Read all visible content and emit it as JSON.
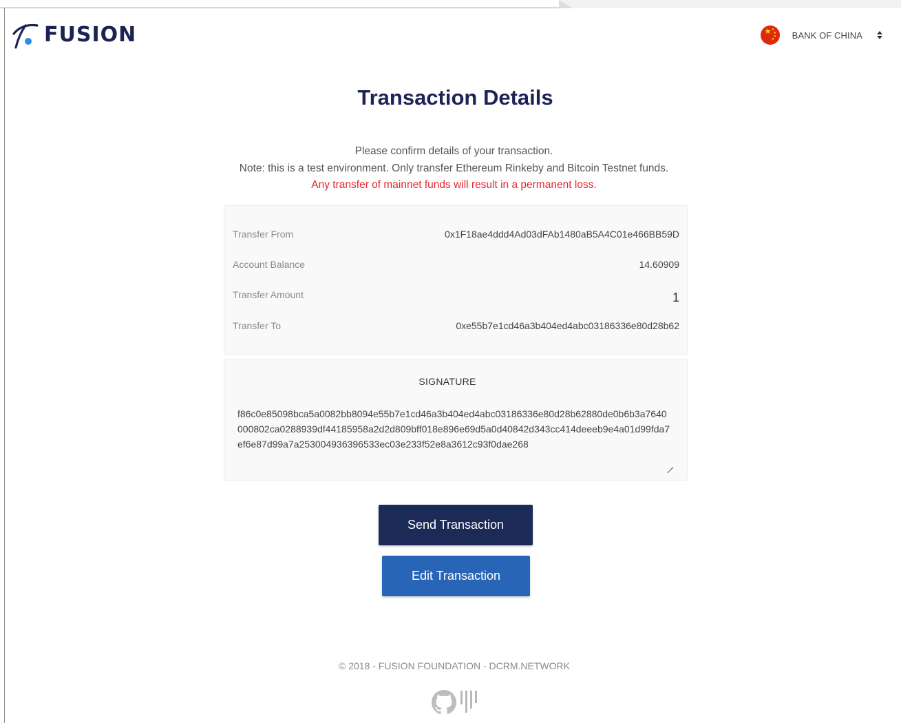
{
  "header": {
    "brand": "FUSION",
    "bank_selector": {
      "selected": "BANK OF CHINA",
      "flag_icon": "china-flag-icon"
    }
  },
  "page": {
    "title": "Transaction Details",
    "notes": {
      "line1": "Please confirm details of your transaction.",
      "line2": "Note: this is a test environment. Only transfer Ethereum Rinkeby and Bitcoin Testnet funds.",
      "warning": "Any transfer of mainnet funds will result in a permanent loss."
    }
  },
  "details": {
    "rows": [
      {
        "label": "Transfer From",
        "value": "0x1F18ae4ddd4Ad03dFAb1480aB5A4C01e466BB59D"
      },
      {
        "label": "Account Balance",
        "value": "14.60909"
      },
      {
        "label": "Transfer Amount",
        "value": "1"
      },
      {
        "label": "Transfer To",
        "value": "0xe55b7e1cd46a3b404ed4abc03186336e80d28b62"
      }
    ]
  },
  "signature": {
    "title": "SIGNATURE",
    "value": "f86c0e85098bca5a0082bb8094e55b7e1cd46a3b404ed4abc03186336e80d28b62880de0b6b3a7640000802ca0288939df44185958a2d2d809bff018e896e69d5a0d40842d343cc414deeeb9e4a01d99fda7ef6e87d99a7a253004936396533ec03e233f52e8a3612c93f0dae268"
  },
  "actions": {
    "send_label": "Send Transaction",
    "edit_label": "Edit Transaction"
  },
  "footer": {
    "copyright": "© 2018 - FUSION FOUNDATION - DCRM.NETWORK",
    "icons": [
      "github-icon",
      "bars-icon"
    ]
  },
  "colors": {
    "navy": "#1b2a57",
    "blue": "#2965b6",
    "title": "#1e2356",
    "warning": "#e3262f"
  }
}
